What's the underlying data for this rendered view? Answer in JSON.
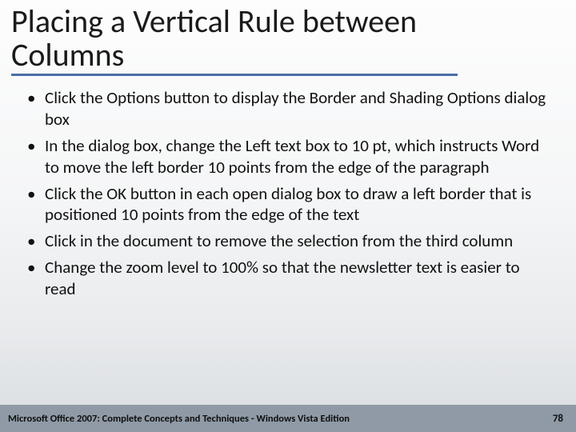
{
  "title": "Placing a Vertical Rule between Columns",
  "bullets": [
    "Click the Options button to display the Border and Shading Options dialog box",
    "In the dialog box, change the Left text box to 10 pt, which instructs Word to move the left border 10 points from the edge of the paragraph",
    "Click the OK button in each open dialog box to draw a left border that is positioned 10 points from the edge of the text",
    "Click in the document to remove the selection from the third column",
    "Change the zoom level to 100% so that the newsletter text is easier to read"
  ],
  "footer": {
    "left": "Microsoft Office 2007: Complete Concepts and Techniques - Windows Vista Edition",
    "page": "78"
  }
}
